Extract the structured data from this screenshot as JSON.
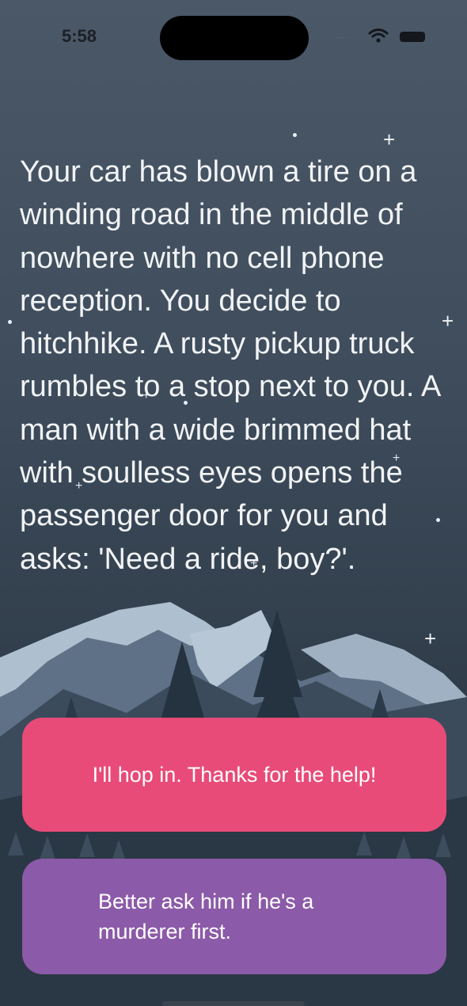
{
  "status_bar": {
    "time": "5:58",
    "signal": "....",
    "icons": [
      "wifi-icon",
      "battery-icon"
    ]
  },
  "story": {
    "text": "Your car has blown a tire on a winding road in the middle of nowhere with no cell phone reception. You decide to hitchhike. A rusty pickup truck rumbles to a stop next to you. A man with a wide brimmed hat with soulless eyes opens the passenger door for you and asks: 'Need a ride, boy?'."
  },
  "choices": [
    {
      "label": "I'll hop in. Thanks for the help!",
      "color": "#e84b78"
    },
    {
      "label": "Better ask him if he's a murderer first.",
      "color": "#8b5aa8"
    }
  ],
  "theme": {
    "background_top": "#4a5868",
    "background_bottom": "#1f2a36",
    "text_color": "#f1f3f5"
  }
}
